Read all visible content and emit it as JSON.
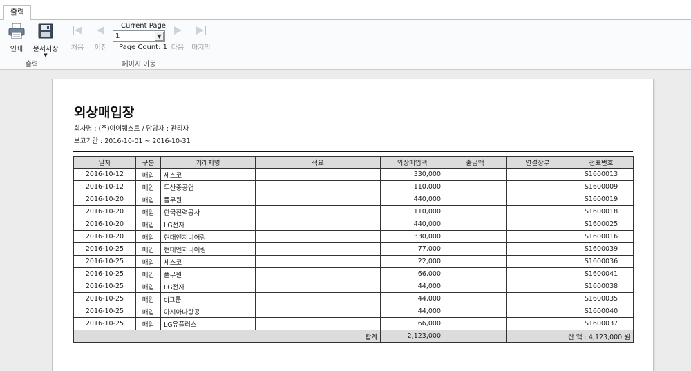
{
  "tab": {
    "label": "출력"
  },
  "ribbon": {
    "print_label": "인쇄",
    "save_label": "문서저장",
    "output_group_label": "출력",
    "current_page_label": "Current Page",
    "current_page_value": "1",
    "page_count_label": "Page Count: 1",
    "first_label": "처음",
    "prev_label": "이전",
    "next_label": "다음",
    "last_label": "마지막",
    "nav_group_label": "페이지 이동"
  },
  "report": {
    "title": "외상매입장",
    "company_line": "회사명 : (주)아이퀘스트 / 담당자 : 관리자",
    "period_line": "보고기간 :  2016-10-01 ~ 2016-10-31",
    "columns": [
      "날자",
      "구분",
      "거래처명",
      "적요",
      "외상매입액",
      "출금액",
      "연결장부",
      "전표번호"
    ],
    "rows": [
      {
        "date": "2016-10-12",
        "type": "매입",
        "partner": "세스코",
        "memo": "",
        "amount": "330,000",
        "out": "",
        "ledger": "",
        "slip": "S1600013"
      },
      {
        "date": "2016-10-12",
        "type": "매입",
        "partner": "두산중공업",
        "memo": "",
        "amount": "110,000",
        "out": "",
        "ledger": "",
        "slip": "S1600009"
      },
      {
        "date": "2016-10-20",
        "type": "매입",
        "partner": "풀무원",
        "memo": "",
        "amount": "440,000",
        "out": "",
        "ledger": "",
        "slip": "S1600019"
      },
      {
        "date": "2016-10-20",
        "type": "매입",
        "partner": "한국전력공사",
        "memo": "",
        "amount": "110,000",
        "out": "",
        "ledger": "",
        "slip": "S1600018"
      },
      {
        "date": "2016-10-20",
        "type": "매입",
        "partner": "LG전자",
        "memo": "",
        "amount": "440,000",
        "out": "",
        "ledger": "",
        "slip": "S1600025"
      },
      {
        "date": "2016-10-20",
        "type": "매입",
        "partner": "현대엔지니어링",
        "memo": "",
        "amount": "330,000",
        "out": "",
        "ledger": "",
        "slip": "S1600016"
      },
      {
        "date": "2016-10-25",
        "type": "매입",
        "partner": "현대엔지니어링",
        "memo": "",
        "amount": "77,000",
        "out": "",
        "ledger": "",
        "slip": "S1600039"
      },
      {
        "date": "2016-10-25",
        "type": "매입",
        "partner": "세스코",
        "memo": "",
        "amount": "22,000",
        "out": "",
        "ledger": "",
        "slip": "S1600036"
      },
      {
        "date": "2016-10-25",
        "type": "매입",
        "partner": "풀무원",
        "memo": "",
        "amount": "66,000",
        "out": "",
        "ledger": "",
        "slip": "S1600041"
      },
      {
        "date": "2016-10-25",
        "type": "매입",
        "partner": "LG전자",
        "memo": "",
        "amount": "44,000",
        "out": "",
        "ledger": "",
        "slip": "S1600038"
      },
      {
        "date": "2016-10-25",
        "type": "매입",
        "partner": "cj그룹",
        "memo": "",
        "amount": "44,000",
        "out": "",
        "ledger": "",
        "slip": "S1600035"
      },
      {
        "date": "2016-10-25",
        "type": "매입",
        "partner": "아시아나항공",
        "memo": "",
        "amount": "44,000",
        "out": "",
        "ledger": "",
        "slip": "S1600040"
      },
      {
        "date": "2016-10-25",
        "type": "매입",
        "partner": "LG유플러스",
        "memo": "",
        "amount": "66,000",
        "out": "",
        "ledger": "",
        "slip": "S1600037"
      }
    ],
    "total_label": "합계",
    "total_amount": "2,123,000",
    "balance_text": "잔 액 : 4,123,000 원"
  }
}
